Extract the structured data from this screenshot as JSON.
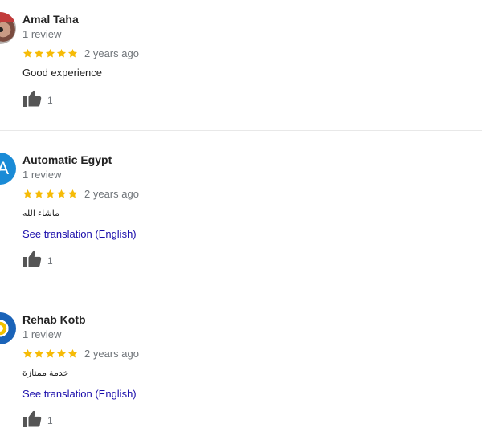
{
  "colors": {
    "star": "#f6bb06",
    "link": "#1a0dab",
    "muted": "#70757a",
    "text": "#222222",
    "thumb": "#555555"
  },
  "reviews": [
    {
      "name": "Amal Taha",
      "review_count": "1 review",
      "rating": 5,
      "date": "2 years ago",
      "text": "Good experience",
      "translation_link": "",
      "likes": "1",
      "avatar": "photo"
    },
    {
      "name": "Automatic Egypt",
      "review_count": "1 review",
      "rating": 5,
      "date": "2 years ago",
      "text": "ماشاء الله",
      "translation_link": "See translation (English)",
      "likes": "1",
      "avatar": "A"
    },
    {
      "name": "Rehab Kotb",
      "review_count": "1 review",
      "rating": 5,
      "date": "2 years ago",
      "text": "خدمة ممتازة",
      "translation_link": "See translation (English)",
      "likes": "1",
      "avatar": "pattern"
    }
  ]
}
